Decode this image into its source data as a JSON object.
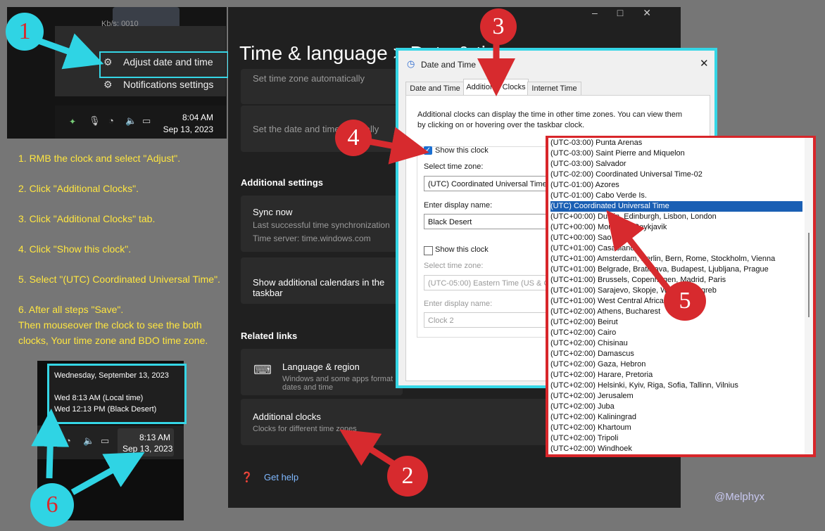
{
  "taskbar_top": {
    "menu_adjust": "Adjust date and time",
    "menu_notifications": "Notifications settings",
    "partial_text": "Kb/s: 0010",
    "time": "8:04 AM",
    "date": "Sep 13, 2023"
  },
  "notes": [
    "1. RMB the clock and select \"Adjust\".",
    "2. Click \"Additional Clocks\".",
    "3. Click \"Additional Clocks\" tab.",
    "4. Click \"Show this clock\".",
    "5. Select \"(UTC) Coordinated Universal Time\".",
    "6. After all steps \"Save\".",
    "Then mouseover the clock to see the both",
    "clocks, Your time zone and BDO time zone."
  ],
  "taskbar_bottom": {
    "popup_date": "Wednesday, September 13, 2023",
    "local": "Wed 8:13 AM (Local time)",
    "bdo": "Wed 12:13 PM (Black Desert)",
    "time": "8:13 AM",
    "date": "Sep 13, 2023"
  },
  "settings": {
    "title": "Time & language",
    "title_partial": "Date & time",
    "auto_tz": "Set time zone automatically",
    "set_date": "Set the date and time manually",
    "additional_settings": "Additional settings",
    "sync_now": "Sync now",
    "sync_last": "Last successful time synchronization",
    "time_server": "Time server: time.windows.com",
    "calendars": "Show additional calendars in the taskbar",
    "related_links": "Related links",
    "lang_region": "Language & region",
    "lang_sub": "Windows and some apps format dates and time",
    "add_clocks": "Additional clocks",
    "add_clocks_sub": "Clocks for different time zones",
    "get_help": "Get help"
  },
  "dialog": {
    "title": "Date and Time",
    "tabs": [
      "Date and Time",
      "Additional Clocks",
      "Internet Time"
    ],
    "description": "Additional clocks can display the time in other time zones. You can view them by clicking on or hovering over the taskbar clock.",
    "show_clock_1": "Show this clock",
    "select_tz": "Select time zone:",
    "tz_value_1": "(UTC) Coordinated Universal Time",
    "display_name_label": "Enter display name:",
    "display_name_1": "Black Desert",
    "show_clock_2": "Show this clock",
    "select_tz_2": "Select time zone:",
    "tz_value_2": "(UTC-05:00) Eastern Time (US & Canada)",
    "display_name_label_2": "Enter display name:",
    "display_name_2": "Clock 2"
  },
  "timezones": [
    "(UTC-03:00) Punta Arenas",
    "(UTC-03:00) Saint Pierre and Miquelon",
    "(UTC-03:00) Salvador",
    "(UTC-02:00) Coordinated Universal Time-02",
    "(UTC-01:00) Azores",
    "(UTC-01:00) Cabo Verde Is.",
    "(UTC) Coordinated Universal Time",
    "(UTC+00:00) Dublin, Edinburgh, Lisbon, London",
    "(UTC+00:00) Monrovia, Reykjavik",
    "(UTC+00:00) Sao Tome",
    "(UTC+01:00) Casablanca",
    "(UTC+01:00) Amsterdam, Berlin, Bern, Rome, Stockholm, Vienna",
    "(UTC+01:00) Belgrade, Bratislava, Budapest, Ljubljana, Prague",
    "(UTC+01:00) Brussels, Copenhagen, Madrid, Paris",
    "(UTC+01:00) Sarajevo, Skopje, Warsaw, Zagreb",
    "(UTC+01:00) West Central Africa",
    "(UTC+02:00) Athens, Bucharest",
    "(UTC+02:00) Beirut",
    "(UTC+02:00) Cairo",
    "(UTC+02:00) Chisinau",
    "(UTC+02:00) Damascus",
    "(UTC+02:00) Gaza, Hebron",
    "(UTC+02:00) Harare, Pretoria",
    "(UTC+02:00) Helsinki, Kyiv, Riga, Sofia, Tallinn, Vilnius",
    "(UTC+02:00) Jerusalem",
    "(UTC+02:00) Juba",
    "(UTC+02:00) Kaliningrad",
    "(UTC+02:00) Khartoum",
    "(UTC+02:00) Tripoli",
    "(UTC+02:00) Windhoek"
  ],
  "selected_index": 6,
  "steps": [
    "1",
    "2",
    "3",
    "4",
    "5",
    "6"
  ],
  "watermark": "@Melphyx",
  "colors": {
    "arrow_red": "#d72a2e",
    "arrow_cyan": "#2fd4e4",
    "note_yellow": "#ffe640",
    "select_blue": "#1a5fb4"
  }
}
